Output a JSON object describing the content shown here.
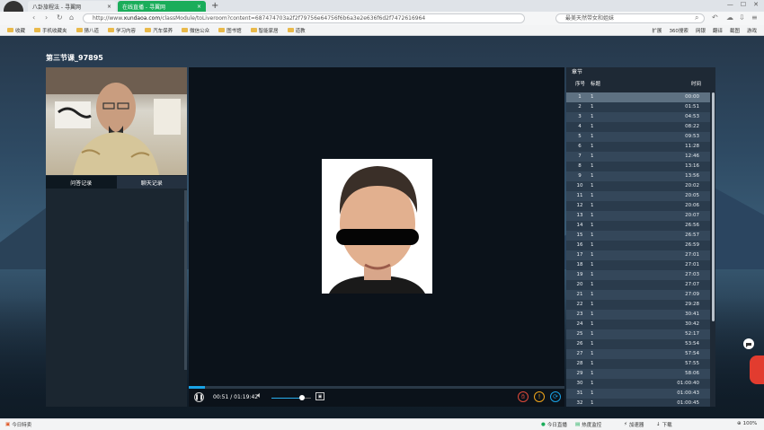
{
  "browser": {
    "tabs": [
      {
        "label": "八卦旅程法 - 寻翼网",
        "active": false
      },
      {
        "label": "在线直播 - 寻翼网",
        "active": true
      }
    ],
    "address_prefix": "http://www.",
    "address_domain": "xundaoa.com",
    "address_path": "/classModule/toLiveroom?content=687474703a2f2f79756e64756f6b6a3e2e636f6d2f7472616964",
    "search_text": "最美天然带女和姐妹",
    "bookmarks": [
      "收藏",
      "手机收藏夹",
      "猜八道",
      "学习内容",
      "汽车保养",
      "微信公众",
      "图书馆",
      "智能家居",
      "道教"
    ],
    "bookmarks_right": [
      "扩展",
      "360搜索",
      "网银",
      "翻译",
      "截图",
      "游戏"
    ],
    "colors": {
      "tab_active": "#1aad5a",
      "accent": "#19a3e6"
    }
  },
  "page": {
    "course_title": "第三节课_97895",
    "left_tabs": [
      "问答记录",
      "聊天记录"
    ],
    "player": {
      "time_display": "00:51 / 01:19:42",
      "progress": 0.011,
      "volume": 0.77
    },
    "chapters": {
      "header": "章节",
      "columns": {
        "index": "序号",
        "title": "标题",
        "time": "时间"
      },
      "rows": [
        {
          "n": "1",
          "t": "1",
          "d": "00:00"
        },
        {
          "n": "2",
          "t": "1",
          "d": "01:51"
        },
        {
          "n": "3",
          "t": "1",
          "d": "04:53"
        },
        {
          "n": "4",
          "t": "1",
          "d": "08:22"
        },
        {
          "n": "5",
          "t": "1",
          "d": "09:53"
        },
        {
          "n": "6",
          "t": "1",
          "d": "11:28"
        },
        {
          "n": "7",
          "t": "1",
          "d": "12:46"
        },
        {
          "n": "8",
          "t": "1",
          "d": "13:16"
        },
        {
          "n": "9",
          "t": "1",
          "d": "13:56"
        },
        {
          "n": "10",
          "t": "1",
          "d": "20:02"
        },
        {
          "n": "11",
          "t": "1",
          "d": "20:05"
        },
        {
          "n": "12",
          "t": "1",
          "d": "20:06"
        },
        {
          "n": "13",
          "t": "1",
          "d": "20:07"
        },
        {
          "n": "14",
          "t": "1",
          "d": "26:56"
        },
        {
          "n": "15",
          "t": "1",
          "d": "26:57"
        },
        {
          "n": "16",
          "t": "1",
          "d": "26:59"
        },
        {
          "n": "17",
          "t": "1",
          "d": "27:01"
        },
        {
          "n": "18",
          "t": "1",
          "d": "27:01"
        },
        {
          "n": "19",
          "t": "1",
          "d": "27:03"
        },
        {
          "n": "20",
          "t": "1",
          "d": "27:07"
        },
        {
          "n": "21",
          "t": "1",
          "d": "27:09"
        },
        {
          "n": "22",
          "t": "1",
          "d": "29:28"
        },
        {
          "n": "23",
          "t": "1",
          "d": "30:41"
        },
        {
          "n": "24",
          "t": "1",
          "d": "30:42"
        },
        {
          "n": "25",
          "t": "1",
          "d": "52:17"
        },
        {
          "n": "26",
          "t": "1",
          "d": "53:54"
        },
        {
          "n": "27",
          "t": "1",
          "d": "57:54"
        },
        {
          "n": "28",
          "t": "1",
          "d": "57:55"
        },
        {
          "n": "29",
          "t": "1",
          "d": "58:06"
        },
        {
          "n": "30",
          "t": "1",
          "d": "01:00:40"
        },
        {
          "n": "31",
          "t": "1",
          "d": "01:00:43"
        },
        {
          "n": "32",
          "t": "1",
          "d": "01:00:45"
        }
      ]
    }
  },
  "statusbar": {
    "left": "今日特卖",
    "items": [
      "今日直播",
      "热度监控",
      "加速器",
      "下载"
    ],
    "zoom": "100%"
  }
}
